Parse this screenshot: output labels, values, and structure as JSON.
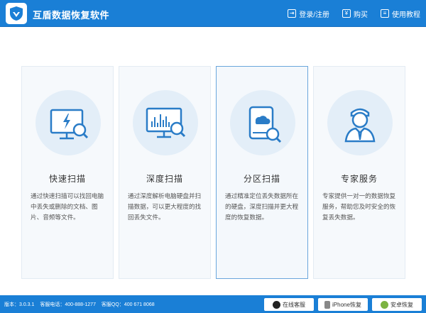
{
  "app": {
    "title": "互盾数据恢复软件",
    "brand_color": "#1a7fd6"
  },
  "header": {
    "actions": [
      {
        "label": "登录/注册",
        "icon": "login-icon"
      },
      {
        "label": "购买",
        "icon": "cart-icon"
      },
      {
        "label": "使用教程",
        "icon": "book-icon"
      }
    ]
  },
  "cards": [
    {
      "title": "快速扫描",
      "icon": "monitor-lightning-search-icon",
      "description": "通过快速扫描可以找回电脑中丢失或删除的文档、图片、音频等文件。",
      "selected": false
    },
    {
      "title": "深度扫描",
      "icon": "monitor-chart-search-icon",
      "description": "通过深度解析电脑硬盘并扫描数据，可以更大程度的找回丢失文件。",
      "selected": false
    },
    {
      "title": "分区扫描",
      "icon": "disk-cloud-search-icon",
      "description": "通过精准定位丢失数据所在的硬盘，深度扫描并更大程度的恢复数据。",
      "selected": true
    },
    {
      "title": "专家服务",
      "icon": "expert-person-icon",
      "description": "专家提供一对一的数据恢复服务，帮助您及时安全的恢复丢失数据。",
      "selected": false
    }
  ],
  "status": {
    "version": "版本：3.0.3.1",
    "phone": "客服电话：400-888-1277",
    "qq": "客服QQ：400 671 8068",
    "buttons": [
      {
        "label": "在线客服",
        "icon": "qq-penguin-icon"
      },
      {
        "label": "iPhone恢复",
        "icon": "iphone-icon"
      },
      {
        "label": "安卓恢复",
        "icon": "android-icon"
      }
    ]
  }
}
